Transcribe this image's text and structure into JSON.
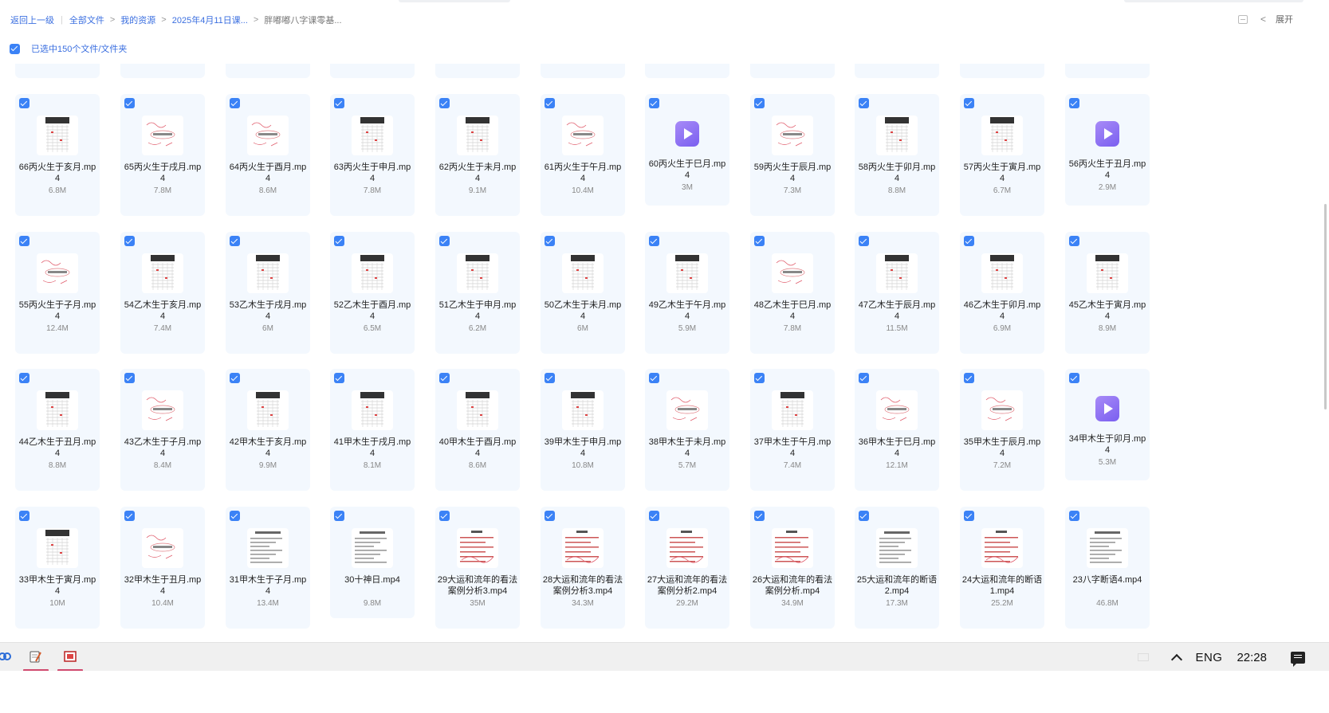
{
  "breadcrumb": {
    "back": "返回上一级",
    "items": [
      "全部文件",
      "我的资源",
      "2025年4月11日课..."
    ],
    "current": "胖嘟嘟八字课零基..."
  },
  "toolbar": {
    "expand": "展开"
  },
  "selection": {
    "text": "已选中150个文件/文件夹"
  },
  "rows": [
    [
      {
        "name": "66丙火生于亥月.mp4",
        "size": "6.8M",
        "thumb": "table-icon"
      },
      {
        "name": "65丙火生于戌月.mp4",
        "size": "7.8M",
        "thumb": "note-icon"
      },
      {
        "name": "64丙火生于酉月.mp4",
        "size": "8.6M",
        "thumb": "note-icon"
      },
      {
        "name": "63丙火生于申月.mp4",
        "size": "7.8M",
        "thumb": "table-icon"
      },
      {
        "name": "62丙火生于未月.mp4",
        "size": "9.1M",
        "thumb": "table-icon"
      },
      {
        "name": "61丙火生于午月.mp4",
        "size": "10.4M",
        "thumb": "note-icon"
      },
      {
        "name": "60丙火生于巳月.mp4",
        "size": "3M",
        "thumb": "video-icon"
      },
      {
        "name": "59丙火生于辰月.mp4",
        "size": "7.3M",
        "thumb": "note-icon"
      },
      {
        "name": "58丙火生于卯月.mp4",
        "size": "8.8M",
        "thumb": "table-icon"
      },
      {
        "name": "57丙火生于寅月.mp4",
        "size": "6.7M",
        "thumb": "table-icon"
      },
      {
        "name": "56丙火生于丑月.mp4",
        "size": "2.9M",
        "thumb": "video-icon"
      }
    ],
    [
      {
        "name": "55丙火生于子月.mp4",
        "size": "12.4M",
        "thumb": "note-icon"
      },
      {
        "name": "54乙木生于亥月.mp4",
        "size": "7.4M",
        "thumb": "table-icon"
      },
      {
        "name": "53乙木生于戌月.mp4",
        "size": "6M",
        "thumb": "table-icon"
      },
      {
        "name": "52乙木生于酉月.mp4",
        "size": "6.5M",
        "thumb": "table-icon"
      },
      {
        "name": "51乙木生于申月.mp4",
        "size": "6.2M",
        "thumb": "table-icon"
      },
      {
        "name": "50乙木生于未月.mp4",
        "size": "6M",
        "thumb": "table-icon"
      },
      {
        "name": "49乙木生于午月.mp4",
        "size": "5.9M",
        "thumb": "table-icon"
      },
      {
        "name": "48乙木生于巳月.mp4",
        "size": "7.8M",
        "thumb": "note-icon"
      },
      {
        "name": "47乙木生于辰月.mp4",
        "size": "11.5M",
        "thumb": "table-icon"
      },
      {
        "name": "46乙木生于卯月.mp4",
        "size": "6.9M",
        "thumb": "table-icon"
      },
      {
        "name": "45乙木生于寅月.mp4",
        "size": "8.9M",
        "thumb": "table-icon"
      }
    ],
    [
      {
        "name": "44乙木生于丑月.mp4",
        "size": "8.8M",
        "thumb": "table-icon"
      },
      {
        "name": "43乙木生于子月.mp4",
        "size": "8.4M",
        "thumb": "note-icon"
      },
      {
        "name": "42甲木生于亥月.mp4",
        "size": "9.9M",
        "thumb": "table-icon"
      },
      {
        "name": "41甲木生于戌月.mp4",
        "size": "8.1M",
        "thumb": "table-icon"
      },
      {
        "name": "40甲木生于酉月.mp4",
        "size": "8.6M",
        "thumb": "table-icon"
      },
      {
        "name": "39甲木生于申月.mp4",
        "size": "10.8M",
        "thumb": "table-icon"
      },
      {
        "name": "38甲木生于未月.mp4",
        "size": "5.7M",
        "thumb": "note-icon"
      },
      {
        "name": "37甲木生于午月.mp4",
        "size": "7.4M",
        "thumb": "table-icon"
      },
      {
        "name": "36甲木生于巳月.mp4",
        "size": "12.1M",
        "thumb": "note-icon"
      },
      {
        "name": "35甲木生于辰月.mp4",
        "size": "7.2M",
        "thumb": "note-icon"
      },
      {
        "name": "34甲木生于卯月.mp4",
        "size": "5.3M",
        "thumb": "video-icon"
      }
    ],
    [
      {
        "name": "33甲木生于寅月.mp4",
        "size": "10M",
        "thumb": "table-icon"
      },
      {
        "name": "32甲木生于丑月.mp4",
        "size": "10.4M",
        "thumb": "note-icon"
      },
      {
        "name": "31甲木生于子月.mp4",
        "size": "13.4M",
        "thumb": "text-icon"
      },
      {
        "name": "30十神日.mp4",
        "size": "9.8M",
        "thumb": "text-icon"
      },
      {
        "name": "29大运和流年的看法案例分析3.mp4",
        "size": "35M",
        "thumb": "case-icon"
      },
      {
        "name": "28大运和流年的看法案例分析3.mp4",
        "size": "34.3M",
        "thumb": "case-icon"
      },
      {
        "name": "27大运和流年的看法案例分析2.mp4",
        "size": "29.2M",
        "thumb": "case-icon"
      },
      {
        "name": "26大运和流年的看法案例分析.mp4",
        "size": "34.9M",
        "thumb": "case-icon"
      },
      {
        "name": "25大运和流年的断语2.mp4",
        "size": "17.3M",
        "thumb": "text-icon"
      },
      {
        "name": "24大运和流年的断语1.mp4",
        "size": "25.2M",
        "thumb": "case-icon"
      },
      {
        "name": "23八字断语4.mp4",
        "size": "46.8M",
        "thumb": "text-icon"
      }
    ]
  ],
  "taskbar": {
    "lang": "ENG",
    "time": "22:28"
  },
  "colors": {
    "accent": "#3b82f6",
    "card_bg": "#f3f8fe"
  }
}
